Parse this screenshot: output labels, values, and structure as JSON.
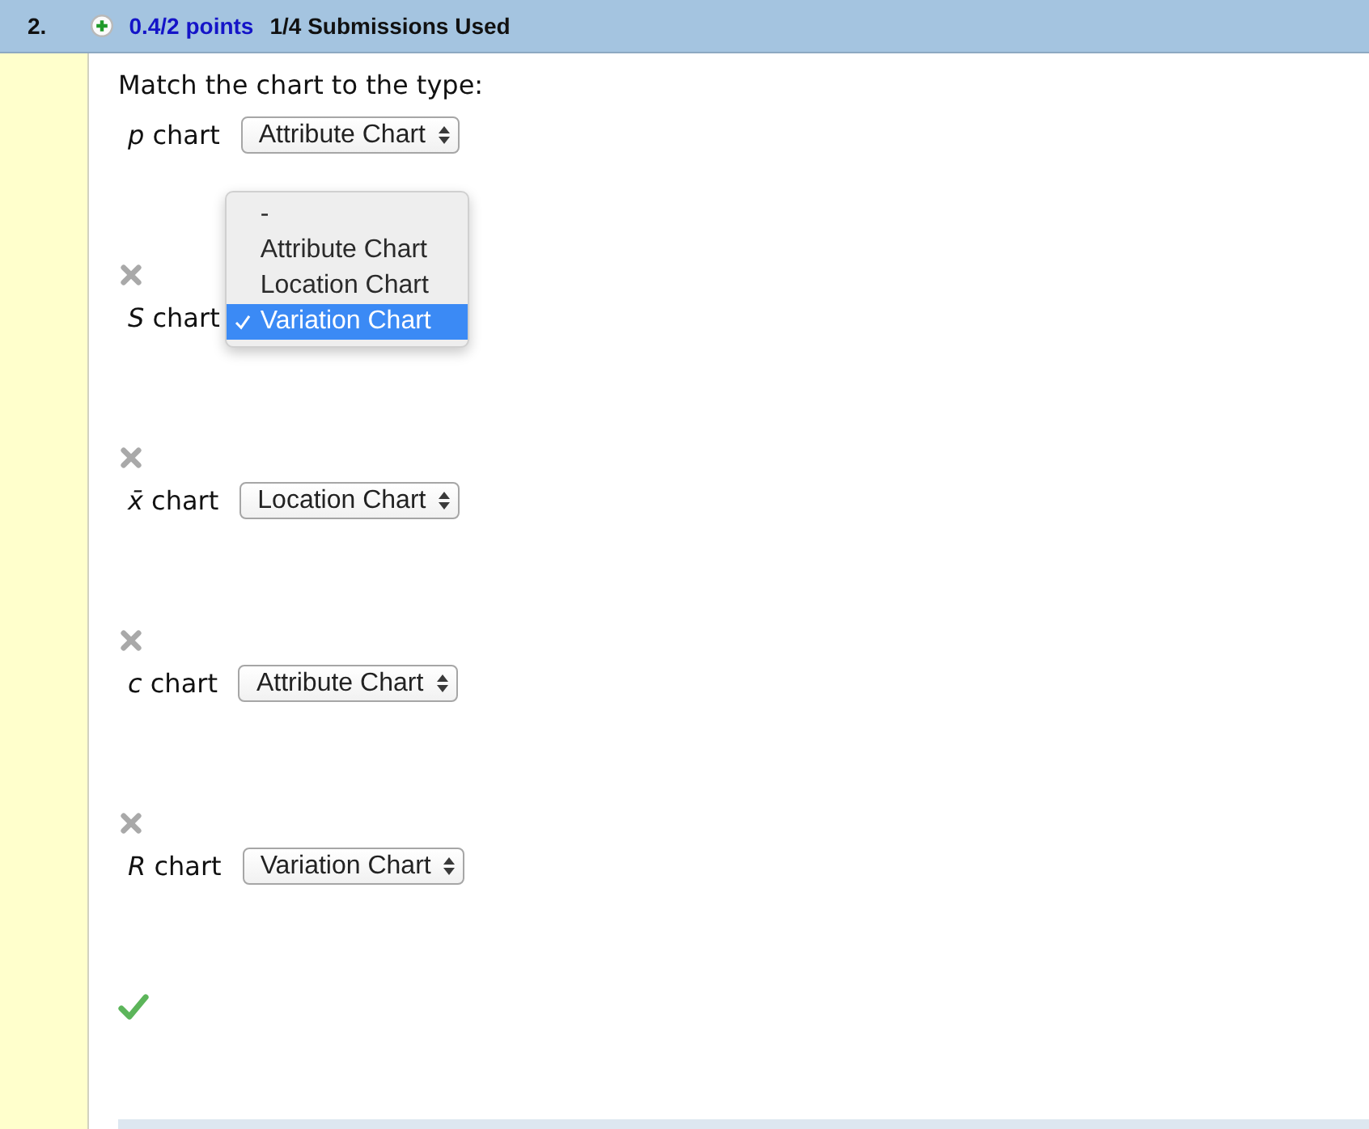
{
  "header": {
    "number": "2.",
    "score": "0.4/2 points",
    "submissions": "1/4 Submissions Used"
  },
  "question": {
    "prompt": "Match the chart to the type:",
    "items": [
      {
        "label": "*p* chart",
        "select": {
          "open": false,
          "value": "Attribute Chart"
        }
      },
      {
        "label": "*S* chart",
        "select": {
          "open": true,
          "options": [
            {
              "label": "-",
              "selected": false
            },
            {
              "label": "Attribute Chart",
              "selected": false
            },
            {
              "label": "Location Chart",
              "selected": false
            },
            {
              "label": "Variation Chart",
              "selected": true
            }
          ]
        }
      },
      {
        "label": "*x̄* chart",
        "select": {
          "open": false,
          "value": "Location Chart"
        }
      },
      {
        "label": "*c* chart",
        "select": {
          "open": false,
          "value": "Attribute Chart"
        }
      },
      {
        "label": "*R* chart",
        "select": {
          "open": false,
          "value": "Variation Chart"
        }
      }
    ],
    "marks": [
      {
        "correct": false
      },
      {
        "correct": false
      },
      {
        "correct": false
      },
      {
        "correct": false
      },
      {
        "correct": true
      }
    ]
  }
}
